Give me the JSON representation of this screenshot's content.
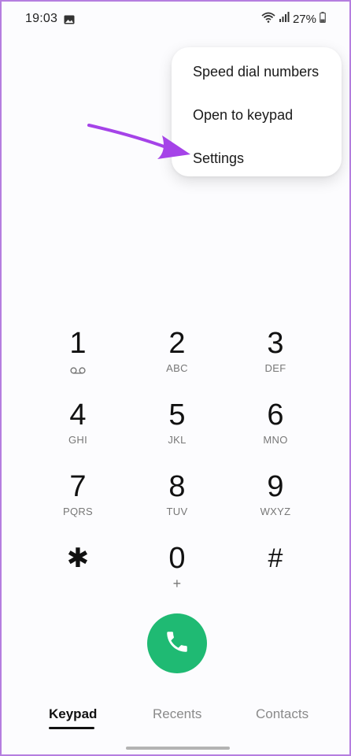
{
  "status_bar": {
    "time": "19:03",
    "battery": "27%",
    "icons": [
      "gallery-icon",
      "wifi-icon",
      "signal-icon",
      "battery-icon"
    ]
  },
  "menu": {
    "items": [
      {
        "label": "Speed dial numbers"
      },
      {
        "label": "Open to keypad"
      },
      {
        "label": "Settings"
      }
    ]
  },
  "annotation": {
    "arrow_color": "#a543e8"
  },
  "keypad": {
    "keys": [
      {
        "digit": "1",
        "letters": ""
      },
      {
        "digit": "2",
        "letters": "ABC"
      },
      {
        "digit": "3",
        "letters": "DEF"
      },
      {
        "digit": "4",
        "letters": "GHI"
      },
      {
        "digit": "5",
        "letters": "JKL"
      },
      {
        "digit": "6",
        "letters": "MNO"
      },
      {
        "digit": "7",
        "letters": "PQRS"
      },
      {
        "digit": "8",
        "letters": "TUV"
      },
      {
        "digit": "9",
        "letters": "WXYZ"
      },
      {
        "digit": "✱",
        "letters": ""
      },
      {
        "digit": "0",
        "letters": "+"
      },
      {
        "digit": "#",
        "letters": ""
      }
    ]
  },
  "call_button": {
    "color": "#1fba73",
    "icon": "phone-icon"
  },
  "tabs": [
    {
      "label": "Keypad",
      "active": true
    },
    {
      "label": "Recents",
      "active": false
    },
    {
      "label": "Contacts",
      "active": false
    }
  ]
}
